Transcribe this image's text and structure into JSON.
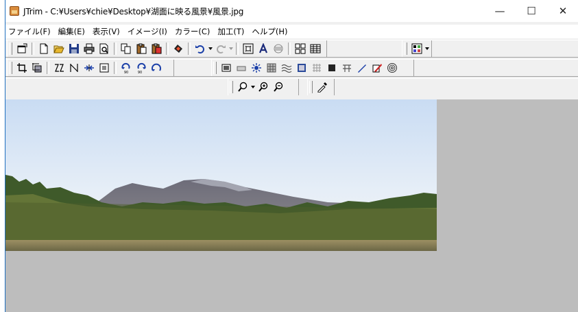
{
  "window": {
    "title": "JTrim - C:¥Users¥chie¥Desktop¥湖面に映る風景¥風景.jpg",
    "controls": {
      "minimize": "—",
      "maximize": "☐",
      "close": "✕"
    }
  },
  "menubar": {
    "items": [
      "ファイル(F)",
      "編集(E)",
      "表示(V)",
      "イメージ(I)",
      "カラー(C)",
      "加工(T)",
      "ヘルプ(H)"
    ]
  },
  "toolbar_icons": {
    "row1": [
      "new-window-icon",
      "new-file-icon",
      "open-folder-icon",
      "save-icon",
      "print-icon",
      "print-preview-icon",
      "copy-icon",
      "paste-icon",
      "paste-new-icon",
      "capture-icon",
      "undo-icon",
      "redo-icon",
      "resize-icon",
      "text-icon",
      "align-icon",
      "grid-icon",
      "thumbnail-icon",
      "color-palette-icon"
    ],
    "row2": [
      "crop-icon",
      "trim-icon",
      "flip-horizontal-icon",
      "flip-vertical-icon",
      "shrink-icon",
      "fit-icon",
      "rotate-90-left-icon",
      "rotate-90-right-icon",
      "rotate-free-icon",
      "grayscale-icon",
      "border-icon",
      "sunburst-icon",
      "mosaic-icon",
      "wave-icon",
      "emboss-icon",
      "texture-icon",
      "dark-frame-icon",
      "comb-icon",
      "pen-icon",
      "eraser-pen-icon",
      "spiral-icon"
    ],
    "row3": [
      "zoom-menu-icon",
      "zoom-in-icon",
      "zoom-out-icon",
      "eyedropper-icon"
    ]
  },
  "colors": {
    "canvas_bg": "#bdbdbd",
    "window_border": "#1f6fbf",
    "toolbar_bg": "#f0f0f0"
  }
}
